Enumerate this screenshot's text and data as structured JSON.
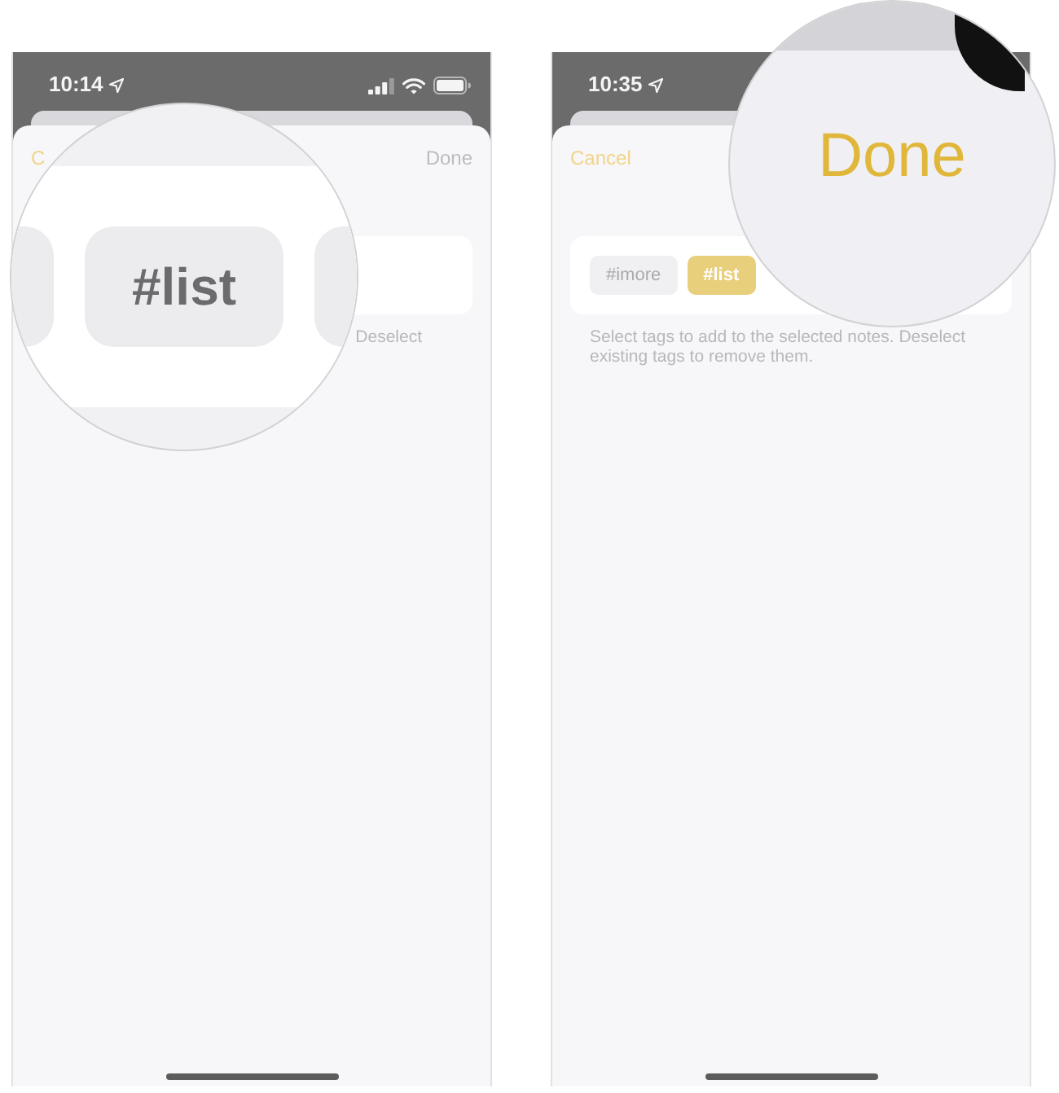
{
  "phones": [
    {
      "status_bar": {
        "time": "10:14",
        "indicators": true
      },
      "sheet": {
        "cancel": "C",
        "done": {
          "label": "Done",
          "disabled": true
        },
        "helper_text": "Deselect"
      },
      "magnifier": {
        "kind": "tag",
        "tag": {
          "label": "#list",
          "selected": false
        }
      }
    },
    {
      "status_bar": {
        "time": "10:35"
      },
      "sheet": {
        "cancel": "Cancel",
        "tags": [
          {
            "label": "#imore",
            "selected": false
          },
          {
            "label": "#list",
            "selected": true
          }
        ],
        "helper_text": "Select tags to add to the selected notes. Deselect existing tags to remove them."
      },
      "magnifier": {
        "kind": "button",
        "label": "Done",
        "disabled": false
      }
    }
  ]
}
